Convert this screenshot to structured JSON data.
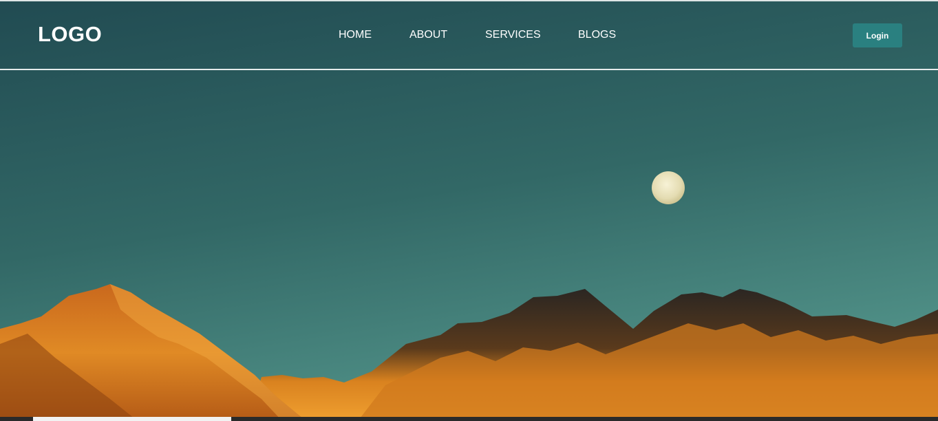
{
  "header": {
    "logo": "LOGO",
    "nav": [
      "HOME",
      "ABOUT",
      "SERVICES",
      "BLOGS"
    ],
    "login_label": "Login"
  },
  "colors": {
    "sky_top": "#234f55",
    "sky_bottom": "#4a8a84",
    "mountain_light": "#e08a25",
    "mountain_dark": "#2a2a2a",
    "button": "#2a8080"
  },
  "hero": {
    "image": "night sky over mountain range with full moon"
  }
}
